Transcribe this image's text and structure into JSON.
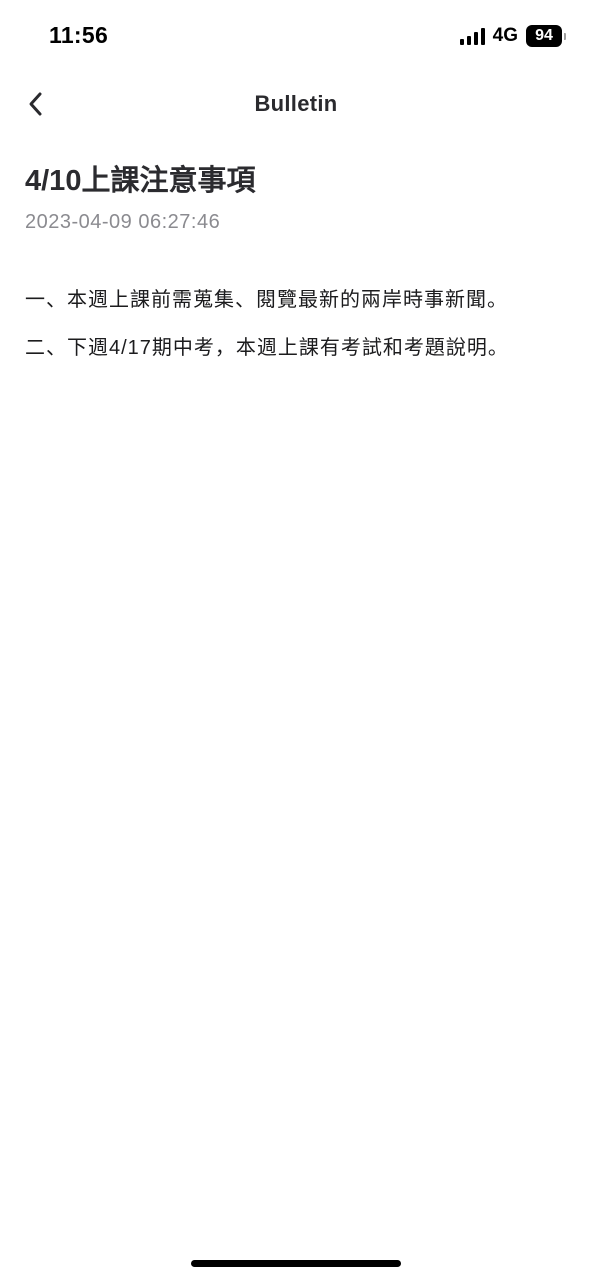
{
  "status_bar": {
    "time": "11:56",
    "network": "4G",
    "battery": "94"
  },
  "nav": {
    "title": "Bulletin",
    "back_icon": "chevron-left-icon"
  },
  "article": {
    "title": "4/10上課注意事項",
    "date": "2023-04-09 06:27:46",
    "lines": [
      "一、本週上課前需蒐集、閱覽最新的兩岸時事新聞。",
      "二、下週4/17期中考，本週上課有考試和考題說明。"
    ]
  }
}
